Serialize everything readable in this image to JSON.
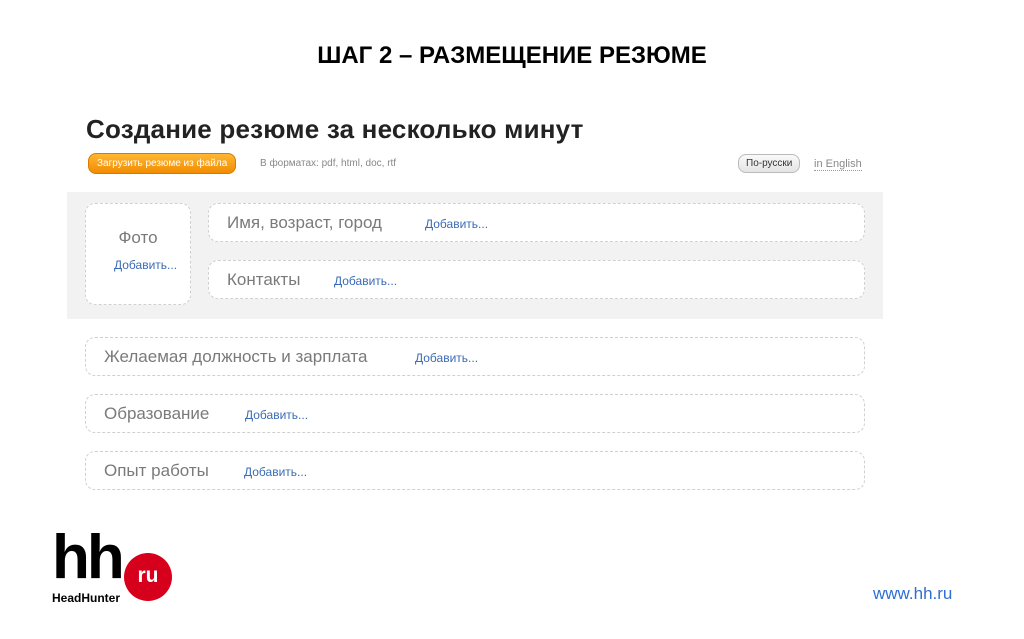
{
  "slide": {
    "title": "ШАГ 2 – РАЗМЕЩЕНИЕ РЕЗЮМЕ"
  },
  "form": {
    "heading": "Создание резюме за несколько минут",
    "upload_button": "Загрузить резюме из файла",
    "formats_note": "В форматах: pdf, html, doc, rtf",
    "lang_ru": "По-русски",
    "lang_en": "in English",
    "add_label": "Добавить...",
    "photo": {
      "label": "Фото",
      "add": "Добавить..."
    },
    "sections": [
      {
        "label": "Имя, возраст, город",
        "add": "Добавить..."
      },
      {
        "label": "Контакты",
        "add": "Добавить..."
      },
      {
        "label": "Желаемая должность и зарплата",
        "add": "Добавить..."
      },
      {
        "label": "Образование",
        "add": "Добавить..."
      },
      {
        "label": "Опыт работы",
        "add": "Добавить..."
      }
    ]
  },
  "branding": {
    "logo_hh": "hh",
    "logo_ru": "ru",
    "logo_sub": "HeadHunter",
    "site": "www.hh.ru",
    "brand_red": "#d6001c",
    "accent_orange": "#f28c00",
    "link_blue": "#3a6bb5"
  }
}
